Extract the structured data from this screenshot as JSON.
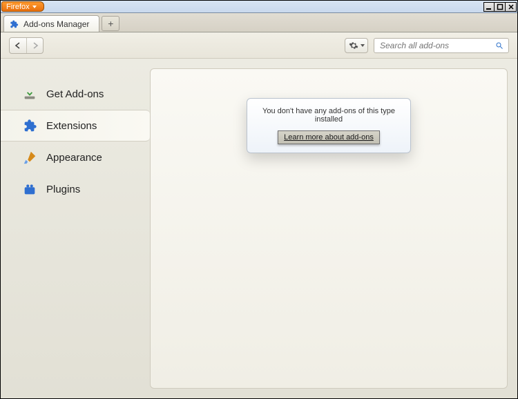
{
  "app_menu_label": "Firefox",
  "tabs": {
    "active_label": "Add-ons Manager",
    "new_tab_glyph": "+"
  },
  "toolbar": {
    "search_placeholder": "Search all add-ons"
  },
  "sidebar": {
    "items": [
      {
        "label": "Get Add-ons"
      },
      {
        "label": "Extensions"
      },
      {
        "label": "Appearance"
      },
      {
        "label": "Plugins"
      }
    ],
    "selected_index": 1
  },
  "content": {
    "empty_message": "You don't have any add-ons of this type installed",
    "learn_more_label": "Learn more about add-ons"
  }
}
